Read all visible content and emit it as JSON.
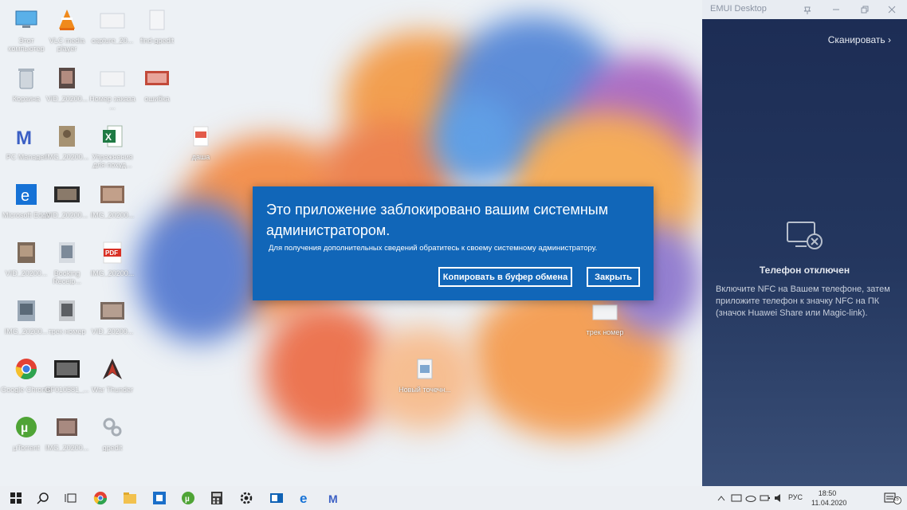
{
  "desktop": {
    "icons": [
      {
        "label": "Этот компьютер",
        "icon": "this-pc-icon"
      },
      {
        "label": "VLC media player",
        "icon": "vlc-icon"
      },
      {
        "label": "capture_20...",
        "icon": "folder-icon"
      },
      {
        "label": "find-gpedit",
        "icon": "file-icon"
      },
      {
        "label": "Корзина",
        "icon": "recycle-bin-icon"
      },
      {
        "label": "VID_20200...",
        "icon": "video-file-icon"
      },
      {
        "label": "Номер заказа ...",
        "icon": "folder-icon"
      },
      {
        "label": "ошибка",
        "icon": "error-image-icon"
      },
      {
        "label": "PC Manager",
        "icon": "pc-manager-icon"
      },
      {
        "label": "IMG_20200...",
        "icon": "image-file-icon"
      },
      {
        "label": "Упражнения для похуд...",
        "icon": "excel-icon"
      },
      {
        "label": "даша",
        "icon": "pdf-file-icon"
      },
      {
        "label": "Microsoft Edge",
        "icon": "edge-icon"
      },
      {
        "label": "VID_20200...",
        "icon": "video-file-icon"
      },
      {
        "label": "IMG_20200...",
        "icon": "image-file-icon"
      },
      {
        "label": "IMG_20200...",
        "icon": "image-file-icon"
      },
      {
        "label": "VID_20200...",
        "icon": "video-file-icon"
      },
      {
        "label": "Booking Receip...",
        "icon": "pdf-icon"
      },
      {
        "label": "IMG_20200...",
        "icon": "image-file-icon"
      },
      {
        "label": "VID_20200...",
        "icon": "video-file-icon"
      },
      {
        "label": "IMG_20200...",
        "icon": "image-file-icon"
      },
      {
        "label": "трек номер",
        "icon": "folder-icon"
      },
      {
        "label": "Google Chrome",
        "icon": "chrome-icon"
      },
      {
        "label": "GF010581_...",
        "icon": "video-file-icon"
      },
      {
        "label": "War Thunder",
        "icon": "war-thunder-icon"
      },
      {
        "label": "Новый точечн...",
        "icon": "bitmap-file-icon"
      },
      {
        "label": "µTorrent",
        "icon": "utorrent-icon"
      },
      {
        "label": "IMG_20200...",
        "icon": "image-file-icon"
      },
      {
        "label": "gpedit",
        "icon": "gpedit-icon"
      }
    ]
  },
  "dialog": {
    "title": "Это приложение заблокировано вашим системным администратором.",
    "message": "Для получения дополнительных сведений обратитесь к своему системному администратору.",
    "copy_label": "Копировать в буфер обмена",
    "close_label": "Закрыть"
  },
  "panel": {
    "title": "EMUI Desktop",
    "scan_label": "Сканировать",
    "phone_status": "Телефон отключен",
    "phone_hint": "Включите NFC на Вашем телефоне, затем приложите телефон к значку NFC на ПК (значок Huawei Share или Magic-link)."
  },
  "taskbar": {
    "apps": [
      "start-icon",
      "search-icon",
      "task-view-icon",
      "chrome-icon",
      "file-explorer-icon",
      "outlook-icon",
      "utorrent-icon",
      "calculator-icon",
      "settings-icon",
      "outlook-mail-icon",
      "edge-icon",
      "pc-manager-icon"
    ],
    "language": "РУС",
    "time": "18:50",
    "date": "11.04.2020",
    "notification_count": "15"
  },
  "colors": {
    "dialog_bg": "#1166b8",
    "panel_bg": "#1c2c54",
    "taskbar_bg": "#eceff3"
  }
}
